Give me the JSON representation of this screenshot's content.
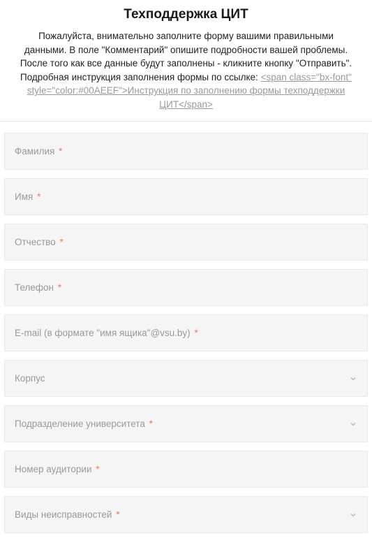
{
  "header": {
    "title": "Техподдержка ЦИТ",
    "description_prefix": "Пожалуйста, внимательно заполните форму вашими правильными данными. В поле \"Комментарий\" опишите подробности вашей проблемы. После того как все данные будут заполнены - кликните кнопку \"Отправить\". Подробная инструкция заполнения формы по ссылке: ",
    "link_text": "<span class=\"bx-font\" style=\"color:#00AEEF\">Инструкция по заполнению формы техподдержки ЦИТ</span>"
  },
  "fields": {
    "surname": {
      "label": "Фамилия",
      "required": true
    },
    "name": {
      "label": "Имя",
      "required": true
    },
    "patronymic": {
      "label": "Отчество",
      "required": true
    },
    "phone": {
      "label": "Телефон",
      "required": true
    },
    "email": {
      "label": "E-mail (в формате \"имя ящика\"@vsu.by)",
      "required": true
    },
    "building": {
      "label": "Корпус",
      "required": false
    },
    "department": {
      "label": "Подразделение университета",
      "required": true
    },
    "room": {
      "label": "Номер аудитории",
      "required": true
    },
    "fault_types": {
      "label": "Виды неисправностей",
      "required": true
    }
  }
}
